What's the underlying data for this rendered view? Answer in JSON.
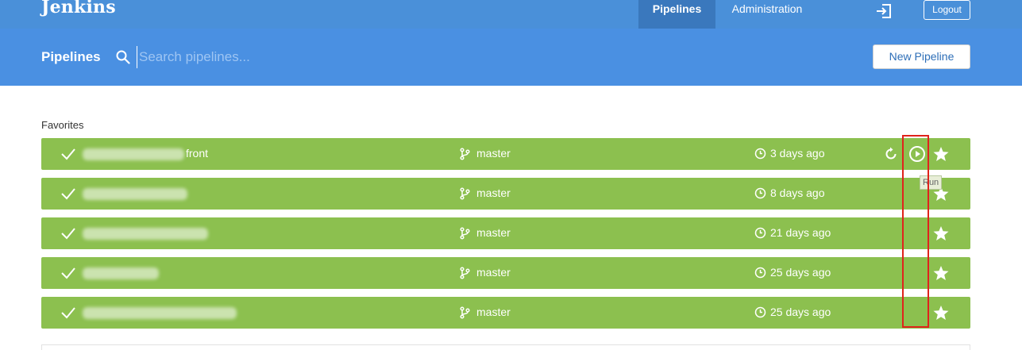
{
  "header": {
    "brand": "Jenkins",
    "nav": [
      {
        "label": "Pipelines",
        "active": true
      },
      {
        "label": "Administration",
        "active": false
      }
    ],
    "logout_label": "Logout",
    "login_icon": "sign-in-icon"
  },
  "subheader": {
    "title": "Pipelines",
    "search_placeholder": "Search pipelines...",
    "new_pipeline_label": "New Pipeline"
  },
  "favorites": {
    "label": "Favorites",
    "rows": [
      {
        "name_suffix": "front",
        "branch": "master",
        "time": "3 days ago",
        "status": "success",
        "show_actions": true
      },
      {
        "name_suffix": "",
        "branch": "master",
        "time": "8 days ago",
        "status": "success",
        "show_actions": false
      },
      {
        "name_suffix": "",
        "branch": "master",
        "time": "21 days ago",
        "status": "success",
        "show_actions": false
      },
      {
        "name_suffix": "",
        "branch": "master",
        "time": "25 days ago",
        "status": "success",
        "show_actions": false
      },
      {
        "name_suffix": "",
        "branch": "master",
        "time": "25 days ago",
        "status": "success",
        "show_actions": false
      }
    ]
  },
  "tooltip": "Run",
  "colors": {
    "topbar": "#4a90d9",
    "subheader": "#4a90e2",
    "success_row": "#8cc04f",
    "highlight": "#e0231c"
  }
}
